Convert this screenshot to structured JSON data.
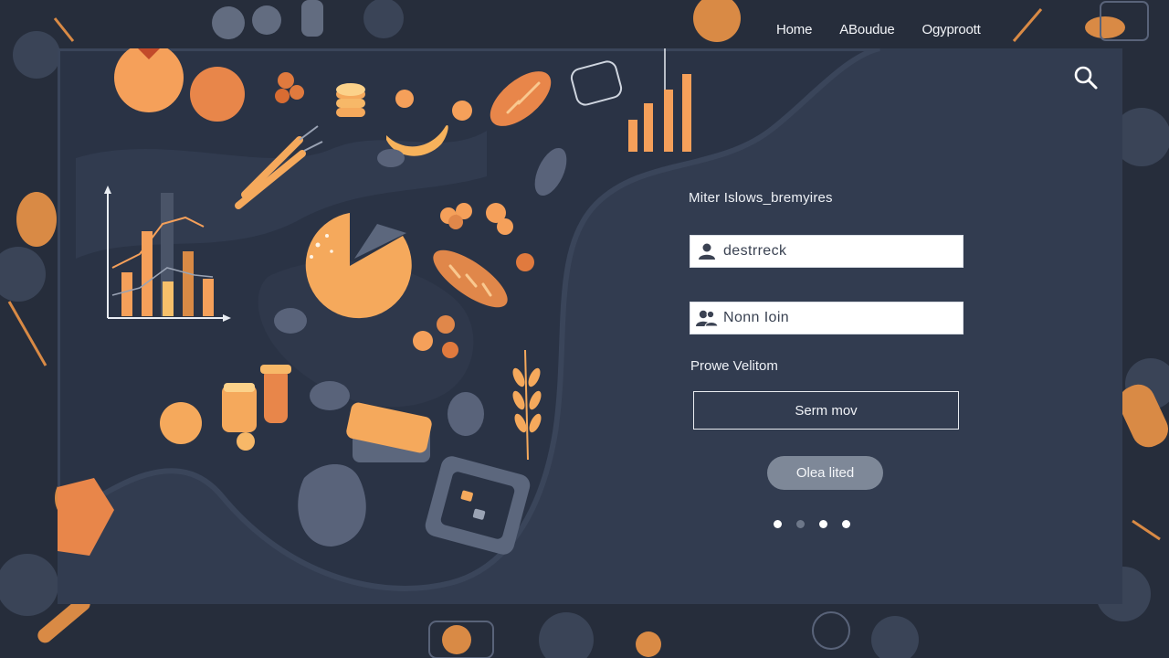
{
  "nav": {
    "items": [
      {
        "label": "Home"
      },
      {
        "label": "ABoudue"
      },
      {
        "label": "Ogyproott"
      }
    ]
  },
  "icons": {
    "search": "search-icon",
    "user": "user-icon",
    "users": "users-icon"
  },
  "form": {
    "title": "Miter Islows_bremyires",
    "username_value": "destrreck",
    "password_value": "Nonn Ioin",
    "provide_label": "Prowe Velitom",
    "outline_button": "Serm mov",
    "pill_button": "Olea lited",
    "carousel": {
      "count": 4,
      "active": [
        0,
        2,
        3
      ]
    }
  },
  "colors": {
    "background": "#262d3b",
    "card": "#323c50",
    "accent_orange": "#f5a05a",
    "pill_button": "#7e8898"
  }
}
